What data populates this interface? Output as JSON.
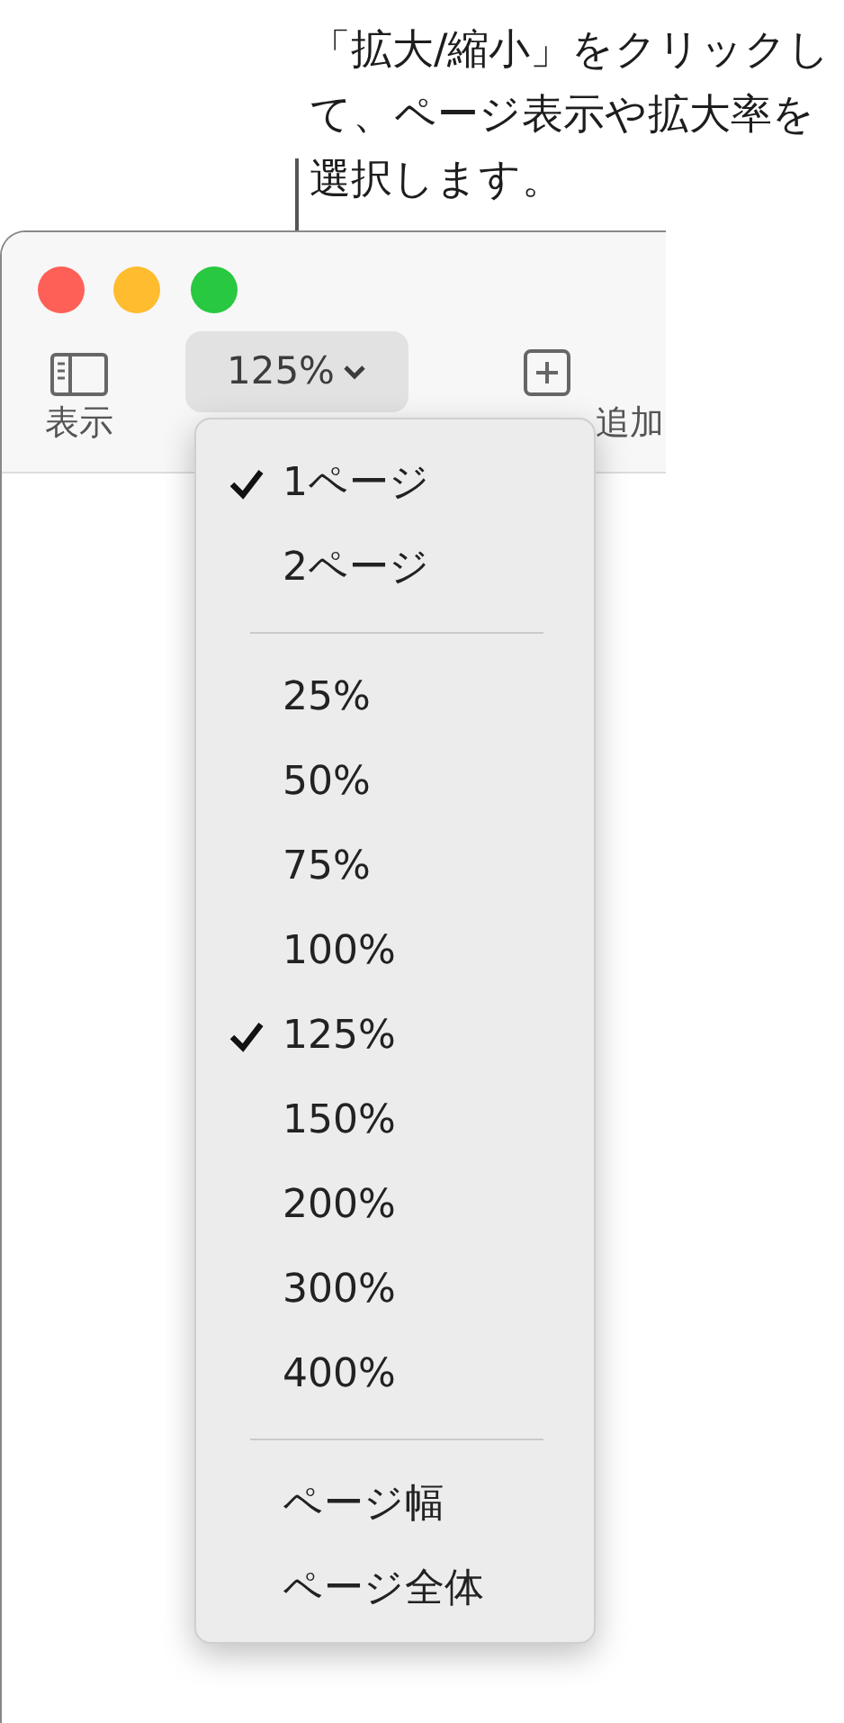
{
  "callout": {
    "text": "「拡大/縮小」をクリックして、ページ表示や拡大率を選択します。"
  },
  "toolbar": {
    "items": [
      {
        "kind": "sidebar",
        "label": "表示"
      },
      {
        "kind": "zoom",
        "label": "125%"
      },
      {
        "kind": "add",
        "label": "追加"
      }
    ]
  },
  "menu": {
    "items": [
      {
        "kind": "item",
        "label": "1ページ",
        "checked": true
      },
      {
        "kind": "item",
        "label": "2ページ",
        "checked": false
      },
      {
        "kind": "separator"
      },
      {
        "kind": "item",
        "label": "25%",
        "checked": false
      },
      {
        "kind": "item",
        "label": "50%",
        "checked": false
      },
      {
        "kind": "item",
        "label": "75%",
        "checked": false
      },
      {
        "kind": "item",
        "label": "100%",
        "checked": false
      },
      {
        "kind": "item",
        "label": "125%",
        "checked": true
      },
      {
        "kind": "item",
        "label": "150%",
        "checked": false
      },
      {
        "kind": "item",
        "label": "200%",
        "checked": false
      },
      {
        "kind": "item",
        "label": "300%",
        "checked": false
      },
      {
        "kind": "item",
        "label": "400%",
        "checked": false
      },
      {
        "kind": "separator"
      },
      {
        "kind": "item",
        "label": "ページ幅",
        "checked": false
      },
      {
        "kind": "item",
        "label": "ページ全体",
        "checked": false
      }
    ]
  }
}
